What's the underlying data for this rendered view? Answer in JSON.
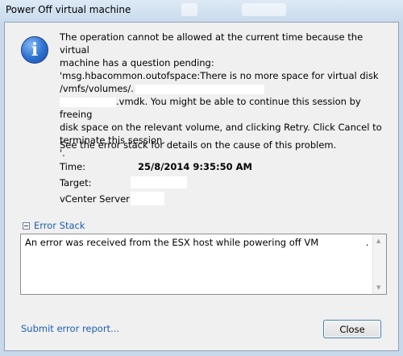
{
  "window": {
    "title": "Power Off virtual machine"
  },
  "message": {
    "line1": "The operation cannot be allowed at the current time because the virtual",
    "line2": "machine has a question pending:",
    "line3": " 'msg.hbacommon.outofspace:There is no more space for virtual disk",
    "line4": "/vmfs/volumes/.",
    "line5": ".vmdk. You might be able to continue this session by freeing",
    "line6": "disk space on the relevant volume, and clicking Retry. Click Cancel to",
    "line7": "terminate this session.",
    "line8": "'.",
    "see_stack": "See the error stack for details on the cause of this problem."
  },
  "fields": {
    "time_label": "Time:",
    "time_value": "25/8/2014 9:35:50 AM",
    "target_label": "Target:",
    "vcenter_label": "vCenter Server:"
  },
  "error_stack": {
    "toggle_label": "Error Stack",
    "text": "An error was received from the ESX host while powering off VM",
    "suffix": "."
  },
  "footer": {
    "report_link": "Submit error report...",
    "close_label": "Close"
  },
  "icons": {
    "info": "info-icon",
    "collapse": "minus-box-icon"
  }
}
